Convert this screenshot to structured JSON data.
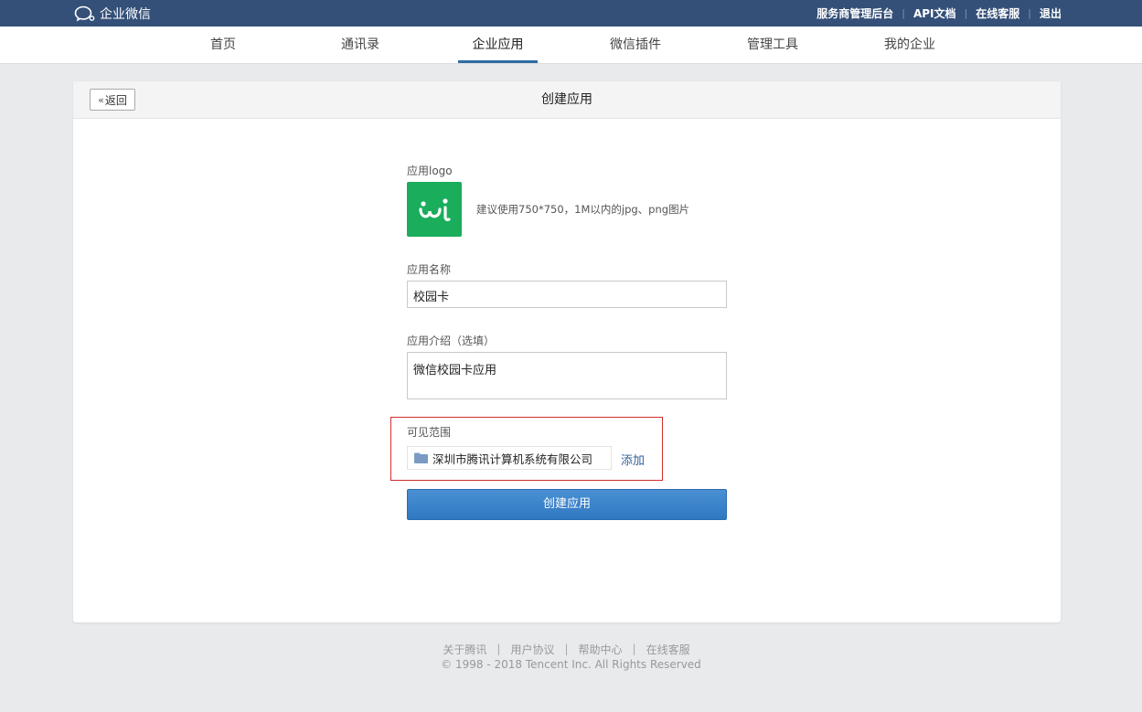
{
  "brand": {
    "name": "企业微信"
  },
  "top_links": [
    "服务商管理后台",
    "API文档",
    "在线客服",
    "退出"
  ],
  "nav": {
    "items": [
      {
        "label": "首页",
        "active": false
      },
      {
        "label": "通讯录",
        "active": false
      },
      {
        "label": "企业应用",
        "active": true
      },
      {
        "label": "微信插件",
        "active": false
      },
      {
        "label": "管理工具",
        "active": false
      },
      {
        "label": "我的企业",
        "active": false
      }
    ]
  },
  "page": {
    "back_label": "返回",
    "title": "创建应用"
  },
  "form": {
    "logo_label": "应用logo",
    "logo_hint": "建议使用750*750，1M以内的jpg、png图片",
    "name_label": "应用名称",
    "name_value": "校园卡",
    "intro_label": "应用介绍（选填）",
    "intro_value": "微信校园卡应用",
    "scope_label": "可见范围",
    "scope_value": "深圳市腾讯计算机系统有限公司",
    "add_label": "添加",
    "submit_label": "创建应用"
  },
  "footer": {
    "links": [
      "关于腾讯",
      "用户协议",
      "帮助中心",
      "在线客服"
    ],
    "copyright": "© 1998 - 2018 Tencent Inc. All Rights Reserved"
  },
  "colors": {
    "topbar": "#345078",
    "accent": "#2e6da4",
    "logo_bg": "#1aad5b",
    "highlight": "#d12d2d"
  }
}
